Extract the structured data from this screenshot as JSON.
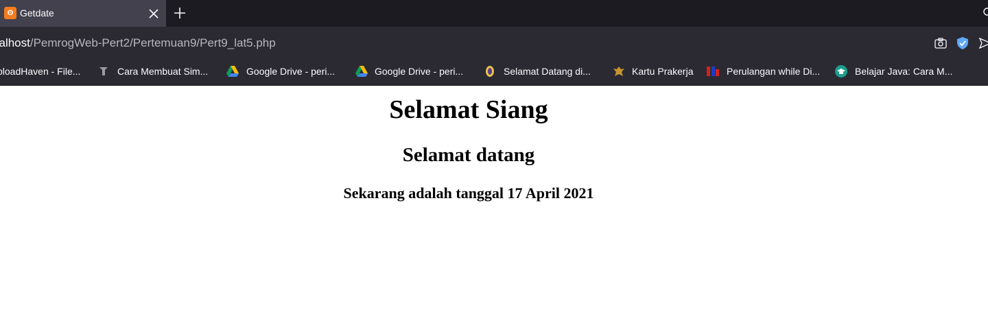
{
  "tab": {
    "title": "Getdate",
    "favicon": "xampp-icon"
  },
  "toolbar": {
    "new_tab_icon": "plus-icon",
    "close_icon": "close-icon"
  },
  "url": {
    "host": "calhost",
    "path": "/PemrogWeb-Pert2/Pertemuan9/Pert9_lat5.php"
  },
  "bookmarks": [
    {
      "label": "ploadHaven - File...",
      "icon": "uploadhaven-icon"
    },
    {
      "label": "Cara Membuat Sim...",
      "icon": "pin-icon"
    },
    {
      "label": "Google Drive - peri...",
      "icon": "google-drive-icon"
    },
    {
      "label": "Google Drive - peri...",
      "icon": "google-drive-icon"
    },
    {
      "label": "Selamat Datang di...",
      "icon": "university-icon"
    },
    {
      "label": "Kartu Prakerja",
      "icon": "garuda-icon"
    },
    {
      "label": "Perulangan while Di...",
      "icon": "site-logo-icon"
    },
    {
      "label": "Belajar Java: Cara M...",
      "icon": "graduation-cap-icon"
    }
  ],
  "page": {
    "greeting": "Selamat Siang",
    "welcome": "Selamat datang",
    "date_line": "Sekarang adalah tanggal 17 April 2021"
  },
  "colors": {
    "tabstrip": "#1c1b22",
    "active_tab": "#42414d",
    "toolbar": "#2b2a33",
    "page_bg": "#ffffff"
  }
}
